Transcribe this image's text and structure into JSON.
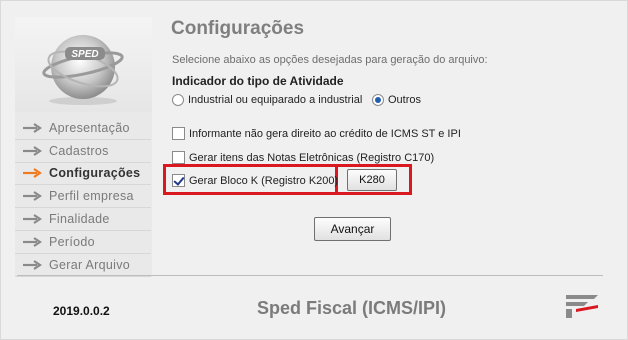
{
  "header": {
    "title": "Configurações",
    "subtitle": "Selecione abaixo as opções desejadas para geração do arquivo:"
  },
  "logo": {
    "text": "SPED"
  },
  "sidebar": {
    "items": [
      {
        "label": "Apresentação",
        "active": false
      },
      {
        "label": "Cadastros",
        "active": false
      },
      {
        "label": "Configurações",
        "active": true
      },
      {
        "label": "Perfil empresa",
        "active": false
      },
      {
        "label": "Finalidade",
        "active": false
      },
      {
        "label": "Período",
        "active": false
      },
      {
        "label": "Gerar Arquivo",
        "active": false
      }
    ]
  },
  "activity": {
    "label": "Indicador do tipo de Atividade",
    "options": [
      {
        "label": "Industrial ou equiparado a industrial",
        "selected": false
      },
      {
        "label": "Outros",
        "selected": true
      }
    ]
  },
  "options": {
    "icms_credit": {
      "label": "Informante não gera direito ao crédito de ICMS ST e IPI",
      "checked": false
    },
    "c170": {
      "label": "Gerar itens das Notas Eletrônicas (Registro C170)",
      "checked": false
    },
    "bloco_k": {
      "label": "Gerar Bloco K (Registro K200)",
      "checked": true
    }
  },
  "buttons": {
    "k280": "K280",
    "next": "Avançar"
  },
  "footer": {
    "version": "2019.0.0.2",
    "title": "Sped Fiscal (ICMS/IPI)"
  },
  "colors": {
    "active_arrow": "#f07a20",
    "inactive_arrow": "#8a8a8a",
    "highlight": "#d9181f",
    "radio_fill": "#1e5fb0"
  }
}
